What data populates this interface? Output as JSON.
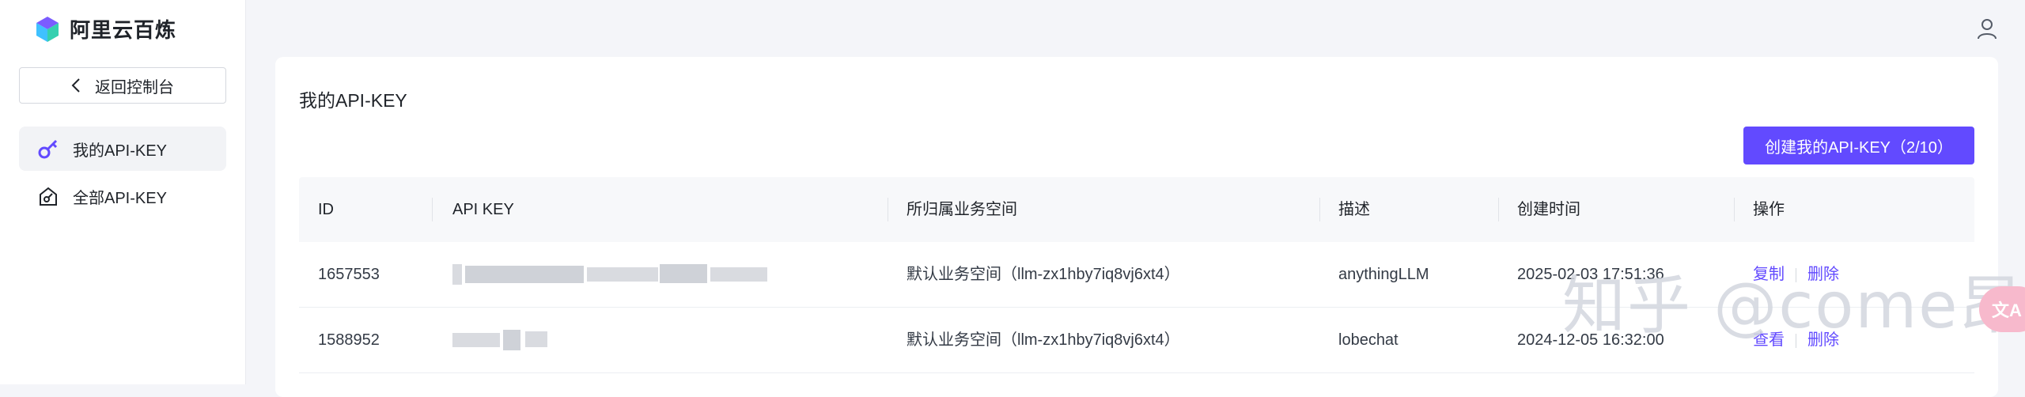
{
  "brand": {
    "name": "阿里云百炼",
    "logo_icon": "bailian-logo-icon"
  },
  "sidebar": {
    "back_label": "返回控制台",
    "items": [
      {
        "label": "我的API-KEY",
        "icon": "key-icon",
        "active": true
      },
      {
        "label": "全部API-KEY",
        "icon": "home-key-icon",
        "active": false
      }
    ]
  },
  "header": {
    "user_icon": "user-icon"
  },
  "main": {
    "title": "我的API-KEY",
    "create_label": "创建我的API-KEY（2/10）",
    "columns": [
      "ID",
      "API KEY",
      "所归属业务空间",
      "描述",
      "创建时间",
      "操作"
    ],
    "rows": [
      {
        "id": "1657553",
        "workspace": "默认业务空间（llm-zx1hby7iq8vj6xt4）",
        "desc": "anythingLLM",
        "time": "2025-02-03 17:51:36",
        "action1": "复制",
        "action2": "删除"
      },
      {
        "id": "1588952",
        "workspace": "默认业务空间（llm-zx1hby7iq8vj6xt4）",
        "desc": "lobechat",
        "time": "2024-12-05 16:32:00",
        "action1": "查看",
        "action2": "删除"
      }
    ]
  },
  "watermark": "知乎 @come昂",
  "float_badge": "文A",
  "colors": {
    "accent": "#624aff",
    "background": "#f4f5f9"
  }
}
